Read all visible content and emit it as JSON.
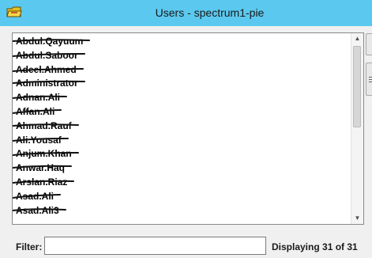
{
  "window": {
    "title": "Users - spectrum1-pie",
    "icon": "folder-icon"
  },
  "user_list": {
    "items": [
      "Abdul.Qayuum",
      "Abdul.Saboor",
      "Adeel.Ahmed",
      "Administrator",
      "Adnan.Ali",
      "Affan.Ali",
      "Ahmad.Rauf",
      "Ali.Yousaf",
      "Anjum.Khan",
      "Anwar.Haq",
      "Arslan.Riaz",
      "Asad.Ali",
      "Asad.Ali3"
    ]
  },
  "filter": {
    "label": "Filter:",
    "value": "",
    "placeholder": ""
  },
  "status": {
    "text": "Displaying 31 of 31"
  }
}
